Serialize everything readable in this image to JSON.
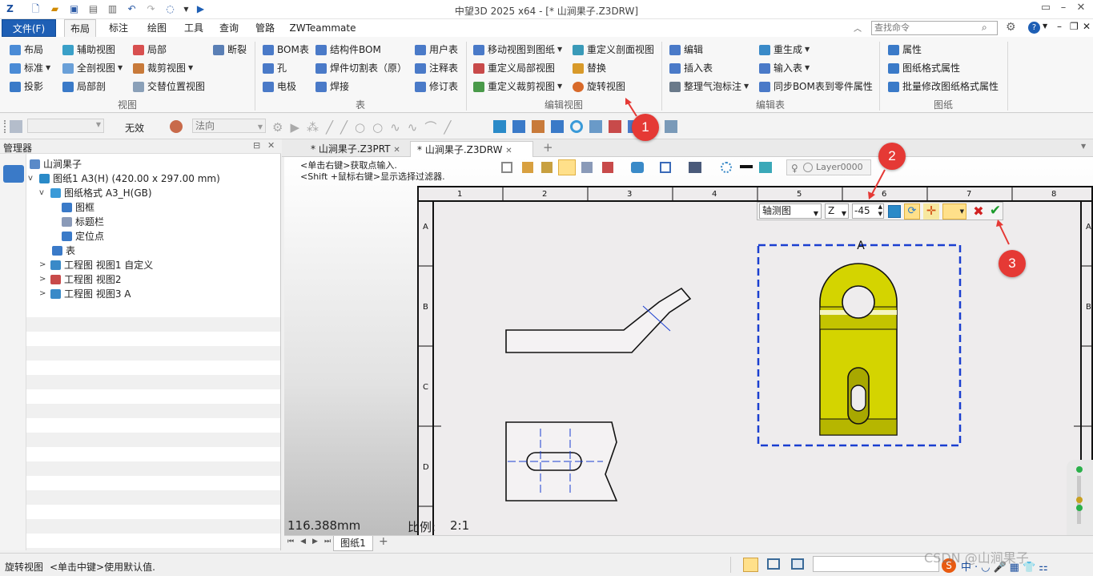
{
  "window": {
    "title": "中望3D 2025 x64 - [* 山涧果子.Z3DRW]"
  },
  "menu": {
    "file": "文件(F)",
    "tabs": [
      "布局",
      "标注",
      "绘图",
      "工具",
      "查询",
      "管路",
      "ZWTeammate"
    ],
    "search_placeholder": "查找命令"
  },
  "ribbon": {
    "view": {
      "label": "视图",
      "items": [
        "布局",
        "辅助视图",
        "局部",
        "断裂",
        "标准",
        "全剖视图",
        "裁剪视图",
        "投影",
        "局部剖",
        "交替位置视图"
      ]
    },
    "table": {
      "label": "表",
      "items": [
        "BOM表",
        "结构件BOM",
        "用户表",
        "孔",
        "焊件切割表（原）",
        "注释表",
        "电极",
        "焊接",
        "修订表"
      ]
    },
    "editview": {
      "label": "编辑视图",
      "items": [
        "移动视图到图纸",
        "重定义剖面视图",
        "重定义局部视图",
        "替换",
        "重定义裁剪视图",
        "旋转视图"
      ]
    },
    "edittable": {
      "label": "编辑表",
      "items": [
        "编辑",
        "重生成",
        "插入表",
        "输入表",
        "整理气泡标注",
        "同步BOM表到零件属性"
      ]
    },
    "sheet": {
      "label": "图纸",
      "items": [
        "属性",
        "图纸格式属性",
        "批量修改图纸格式属性"
      ]
    }
  },
  "toolbar2": {
    "none_label": "无效",
    "normal_label": "法向"
  },
  "manager": {
    "title": "管理器",
    "tree": [
      {
        "label": "山涧果子",
        "level": 0
      },
      {
        "label": "图纸1 A3(H) (420.00 x 297.00 mm)",
        "level": 1
      },
      {
        "label": "图纸格式 A3_H(GB)",
        "level": 2
      },
      {
        "label": "图框",
        "level": 3
      },
      {
        "label": "标题栏",
        "level": 3
      },
      {
        "label": "定位点",
        "level": 3
      },
      {
        "label": "表",
        "level": 2
      },
      {
        "label": "工程图 视图1 自定义",
        "level": 1
      },
      {
        "label": "工程图 视图2",
        "level": 1
      },
      {
        "label": "工程图 视图3 A",
        "level": 1
      }
    ]
  },
  "doctabs": [
    "* 山涧果子.Z3PRT",
    "* 山涧果子.Z3DRW"
  ],
  "prompt": [
    "<单击右键>获取点输入.",
    "<Shift +鼠标右键>显示选择过滤器."
  ],
  "layer": "Layer0000",
  "sheet": {
    "cols": [
      "1",
      "2",
      "3",
      "4",
      "5",
      "6",
      "7",
      "8"
    ],
    "rows": [
      "A",
      "B",
      "C",
      "D"
    ],
    "view_letter": "A"
  },
  "rotate_dialog": {
    "type": "轴测图",
    "axis": "Z",
    "angle": "-45"
  },
  "readout": {
    "distance": "116.388mm",
    "scale_label": "比例:",
    "scale": "2:1"
  },
  "sheet_tab": "图纸1",
  "status": {
    "command": "旋转视图",
    "hint": "<单击中键>使用默认值."
  },
  "callouts": [
    "1",
    "2",
    "3"
  ],
  "watermark": "CSDN @山涧果子",
  "colors": {
    "accent": "#1e5fb5",
    "part_yellow": "#d4d400",
    "selection": "#1a3fd0",
    "callout": "#e53935"
  }
}
